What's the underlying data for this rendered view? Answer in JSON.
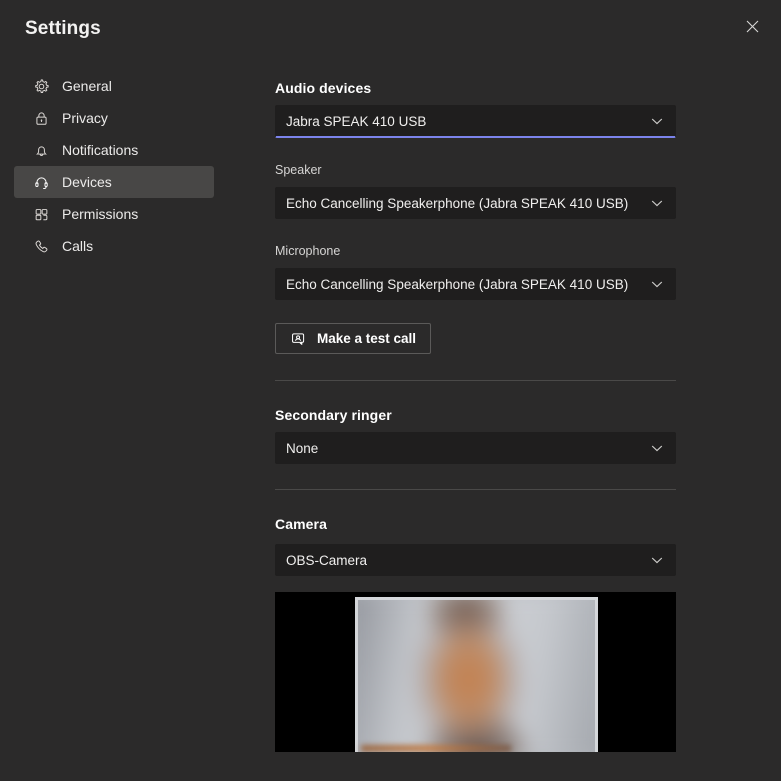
{
  "window": {
    "title": "Settings",
    "close_label": "Close",
    "close_icon": "close-icon",
    "background_color": "#2b2a2a"
  },
  "sidebar": {
    "items": [
      {
        "id": "general",
        "label": "General",
        "icon": "gear-icon",
        "selected": false
      },
      {
        "id": "privacy",
        "label": "Privacy",
        "icon": "lock-icon",
        "selected": false
      },
      {
        "id": "notifications",
        "label": "Notifications",
        "icon": "bell-icon",
        "selected": false
      },
      {
        "id": "devices",
        "label": "Devices",
        "icon": "headset-icon",
        "selected": true
      },
      {
        "id": "permissions",
        "label": "Permissions",
        "icon": "grid-icon",
        "selected": false
      },
      {
        "id": "calls",
        "label": "Calls",
        "icon": "phone-icon",
        "selected": false
      }
    ],
    "selected_background": "#484746"
  },
  "main": {
    "audio_devices": {
      "heading": "Audio devices",
      "dropdown": {
        "value": "Jabra SPEAK 410 USB",
        "icon": "chevron-down-icon",
        "focused": true,
        "focus_color": "#7b83eb"
      }
    },
    "speaker": {
      "label": "Speaker",
      "dropdown": {
        "value": "Echo Cancelling Speakerphone (Jabra SPEAK 410 USB)",
        "icon": "chevron-down-icon"
      }
    },
    "microphone": {
      "label": "Microphone",
      "dropdown": {
        "value": "Echo Cancelling Speakerphone (Jabra SPEAK 410 USB)",
        "icon": "chevron-down-icon"
      }
    },
    "test_call": {
      "label": "Make a test call",
      "icon": "test-call-icon"
    },
    "secondary_ringer": {
      "heading": "Secondary ringer",
      "dropdown": {
        "value": "None",
        "icon": "chevron-down-icon"
      }
    },
    "camera": {
      "heading": "Camera",
      "dropdown": {
        "value": "OBS-Camera",
        "icon": "chevron-down-icon"
      },
      "preview": {
        "name": "camera-preview",
        "letterbox_color": "#000000"
      }
    }
  }
}
